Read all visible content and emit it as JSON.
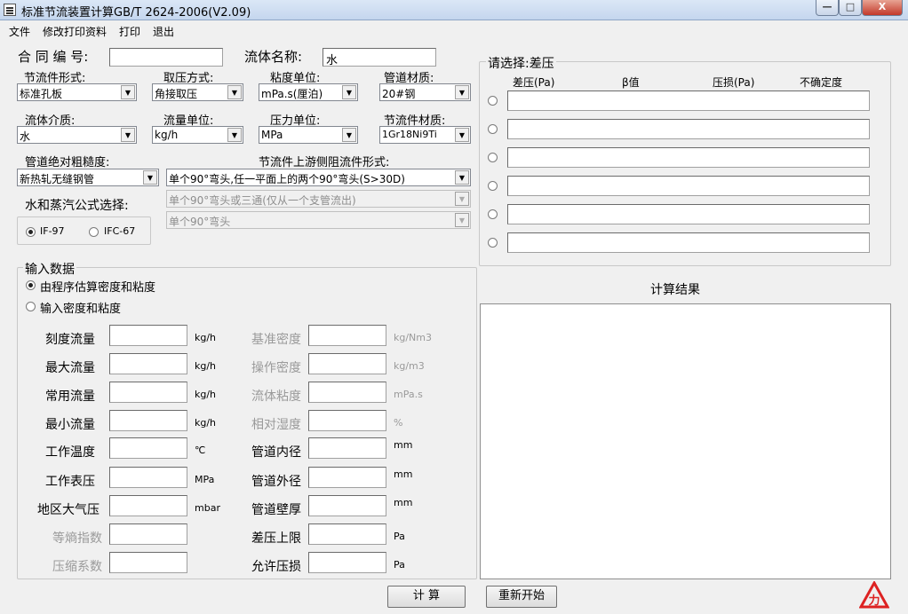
{
  "window": {
    "title": "标准节流装置计算GB/T 2624-2006(V2.09)",
    "minimize": "—",
    "maximize": "□",
    "close": "X"
  },
  "menu": [
    "文件",
    "修改打印资料",
    "打印",
    "退出"
  ],
  "top": {
    "contract_label": "合 同 编 号:",
    "contract_value": "",
    "fluid_name_label": "流体名称:",
    "fluid_name_value": "水",
    "element_type_label": "节流件形式:",
    "element_type_value": "标准孔板",
    "tap_label": "取压方式:",
    "tap_value": "角接取压",
    "visc_unit_label": "粘度单位:",
    "visc_unit_value": "mPa.s(厘泊)",
    "pipe_mat_label": "管道材质:",
    "pipe_mat_value": "20#钢",
    "medium_label": "流体介质:",
    "medium_value": "水",
    "flow_unit_label": "流量单位:",
    "flow_unit_value": "kg/h",
    "press_unit_label": "压力单位:",
    "press_unit_value": "MPa",
    "elem_mat_label": "节流件材质:",
    "elem_mat_value": "1Gr18Ni9Ti",
    "roughness_label": "管道绝对粗糙度:",
    "roughness_value": "新热轧无缝钢管",
    "upstream_label": "节流件上游侧阻流件形式:",
    "upstream1": "单个90°弯头,任一平面上的两个90°弯头(S>30D)",
    "upstream2": "单个90°弯头或三通(仅从一个支管流出)",
    "upstream3": "单个90°弯头",
    "formula_label": "水和蒸汽公式选择:",
    "if97": "IF-97",
    "ifc67": "IFC-67"
  },
  "select": {
    "title": "请选择:差压",
    "headers": [
      "差压(Pa)",
      "β值",
      "压损(Pa)",
      "不确定度"
    ]
  },
  "input": {
    "title": "输入数据",
    "opt1": "由程序估算密度和粘度",
    "opt2": "输入密度和粘度",
    "left": [
      {
        "label": "刻度流量",
        "unit": "kg/h"
      },
      {
        "label": "最大流量",
        "unit": "kg/h"
      },
      {
        "label": "常用流量",
        "unit": "kg/h"
      },
      {
        "label": "最小流量",
        "unit": "kg/h"
      },
      {
        "label": "工作温度",
        "unit": "℃"
      },
      {
        "label": "工作表压",
        "unit": "MPa"
      },
      {
        "label": "地区大气压",
        "unit": "mbar"
      },
      {
        "label": "等熵指数",
        "unit": ""
      },
      {
        "label": "压缩系数",
        "unit": ""
      }
    ],
    "right": [
      {
        "label": "基准密度",
        "unit": "kg/Nm3"
      },
      {
        "label": "操作密度",
        "unit": "kg/m3"
      },
      {
        "label": "流体粘度",
        "unit": "mPa.s"
      },
      {
        "label": "相对湿度",
        "unit": "%"
      },
      {
        "label": "管道内径",
        "unit": "mm"
      },
      {
        "label": "管道外径",
        "unit": "mm"
      },
      {
        "label": "管道壁厚",
        "unit": "mm"
      },
      {
        "label": "差压上限",
        "unit": "Pa"
      },
      {
        "label": "允许压损",
        "unit": "Pa"
      }
    ]
  },
  "result": {
    "title": "计算结果"
  },
  "buttons": {
    "calc": "计  算",
    "restart": "重新开始"
  },
  "logo": {
    "mark": "力"
  }
}
